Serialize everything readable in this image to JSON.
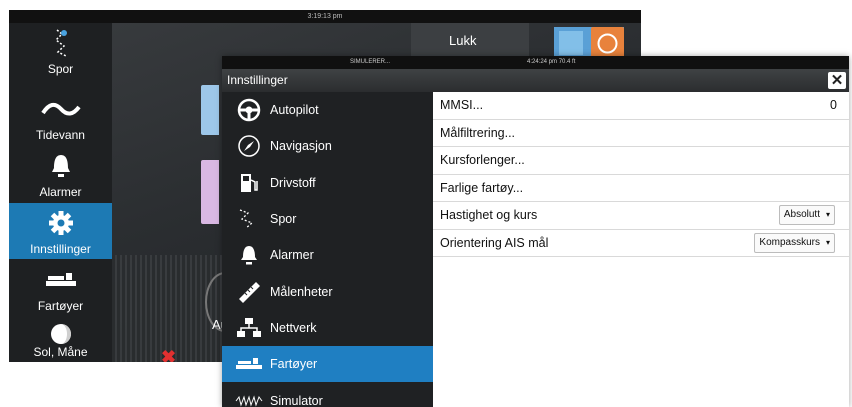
{
  "background": {
    "time": "3:19:13 pm",
    "sidebar": [
      {
        "label": "Spor",
        "icon": "track-icon"
      },
      {
        "label": "Tidevann",
        "icon": "tide-icon"
      },
      {
        "label": "Alarmer",
        "icon": "bell-icon"
      },
      {
        "label": "Innstillinger",
        "icon": "gear-icon",
        "selected": true
      },
      {
        "label": "Fartøyer",
        "icon": "vessels-icon"
      },
      {
        "label": "Sol, Måne",
        "icon": "moon-icon"
      }
    ],
    "close_label": "Lukk",
    "partial_label": "Au"
  },
  "dialog": {
    "status_left": "SIMULERER...",
    "status_right": "4:24:24 pm  70.4 ft",
    "title": "Innstillinger",
    "close": "✕",
    "menu": [
      {
        "label": "Autopilot",
        "icon": "autopilot-icon"
      },
      {
        "label": "Navigasjon",
        "icon": "compass-icon"
      },
      {
        "label": "Drivstoff",
        "icon": "fuel-icon"
      },
      {
        "label": "Spor",
        "icon": "track-icon"
      },
      {
        "label": "Alarmer",
        "icon": "bell-icon"
      },
      {
        "label": "Målenheter",
        "icon": "ruler-icon"
      },
      {
        "label": "Nettverk",
        "icon": "network-icon"
      },
      {
        "label": "Fartøyer",
        "icon": "vessels-icon",
        "selected": true
      },
      {
        "label": "Simulator",
        "icon": "simulator-icon"
      }
    ],
    "settings": [
      {
        "label": "MMSI...",
        "value": "0"
      },
      {
        "label": "Målfiltrering..."
      },
      {
        "label": "Kursforlenger..."
      },
      {
        "label": "Farlige fartøy..."
      },
      {
        "label": "Hastighet og kurs",
        "dropdown": "Absolutt"
      },
      {
        "label": "Orientering AIS mål",
        "dropdown": "Kompasskurs"
      }
    ]
  },
  "colors": {
    "accent": "#1f7fc2",
    "sidebar_dark": "#1f2123",
    "alarm_red": "#e23030"
  }
}
